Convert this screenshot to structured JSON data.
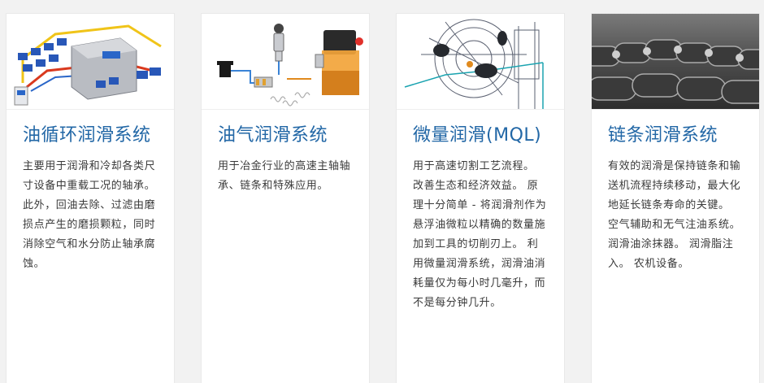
{
  "cards": [
    {
      "title": "油循环润滑系统",
      "description": "主要用于润滑和冷却各类尺寸设备中重载工况的轴承。 此外，回油去除、过滤由磨损点产生的磨损颗粒，同时消除空气和水分防止轴承腐蚀。",
      "image_icon": "oil-circulation-system-illustration"
    },
    {
      "title": "油气润滑系统",
      "description": "用于冶金行业的高速主轴轴承、链条和特殊应用。",
      "image_icon": "oil-air-lubrication-illustration"
    },
    {
      "title": "微量润滑(MQL)",
      "description": "用于高速切割工艺流程。 改善生态和经济效益。 原理十分简单 - 将润滑剂作为悬浮油微粒以精确的数量施加到工具的切削刃上。 利用微量润滑系统，润滑油消耗量仅为每小时几毫升，而不是每分钟几升。",
      "image_icon": "mql-spindle-drawing"
    },
    {
      "title": "链条润滑系统",
      "description": "有效的润滑是保持链条和输送机流程持续移动，最大化地延长链条寿命的关键。 空气辅助和无气注油系统。 润滑油涂抹器。 润滑脂注入。 农机设备。",
      "image_icon": "roller-chain-photo"
    }
  ],
  "colors": {
    "title": "#2267a6",
    "text": "#3a3a3a",
    "card_bg": "#ffffff",
    "page_bg": "#f2f2f2"
  }
}
